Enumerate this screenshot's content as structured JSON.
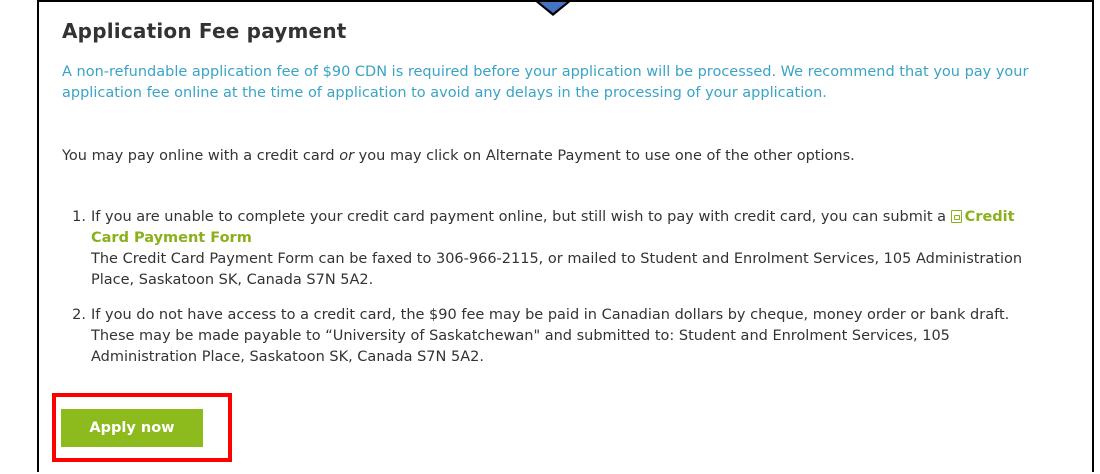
{
  "section": {
    "title": "Application Fee payment",
    "intro": "A non-refundable application fee of $90 CDN is required before your application will be processed. We recommend that you pay your application fee online at the time of application to avoid any delays in the processing of your application.",
    "pay_text_before": "You may pay online with a credit card ",
    "pay_text_em": "or",
    "pay_text_after": " you may click on Alternate Payment to use one of the other options."
  },
  "options": [
    {
      "number": "1.",
      "text_before": "If you are unable to complete your credit card payment online, but still wish to pay with credit card, you can submit a ",
      "link_label": "Credit Card Payment Form",
      "text_after": "The Credit Card Payment Form can be faxed to 306-966-2115, or mailed to Student and Enrolment Services, 105 Administration Place, Saskatoon SK, Canada S7N 5A2."
    },
    {
      "number": "2.",
      "text": "If you do not have access to a credit card, the $90 fee may be paid in Canadian dollars by cheque, money order or bank draft. These may be made payable to “University of Saskatchewan\" and submitted to: Student and Enrolment Services, 105 Administration Place, Saskatoon SK, Canada S7N 5A2."
    }
  ],
  "apply_button_label": "Apply now",
  "colors": {
    "intro_text": "#3aa3c6",
    "link": "#8ab11a",
    "button": "#8dba1d",
    "highlight": "#ff0000",
    "arrow": "#4472c4"
  },
  "icons": {
    "pdf": "pdf-file-icon",
    "arrow": "down-arrow-indicator"
  }
}
